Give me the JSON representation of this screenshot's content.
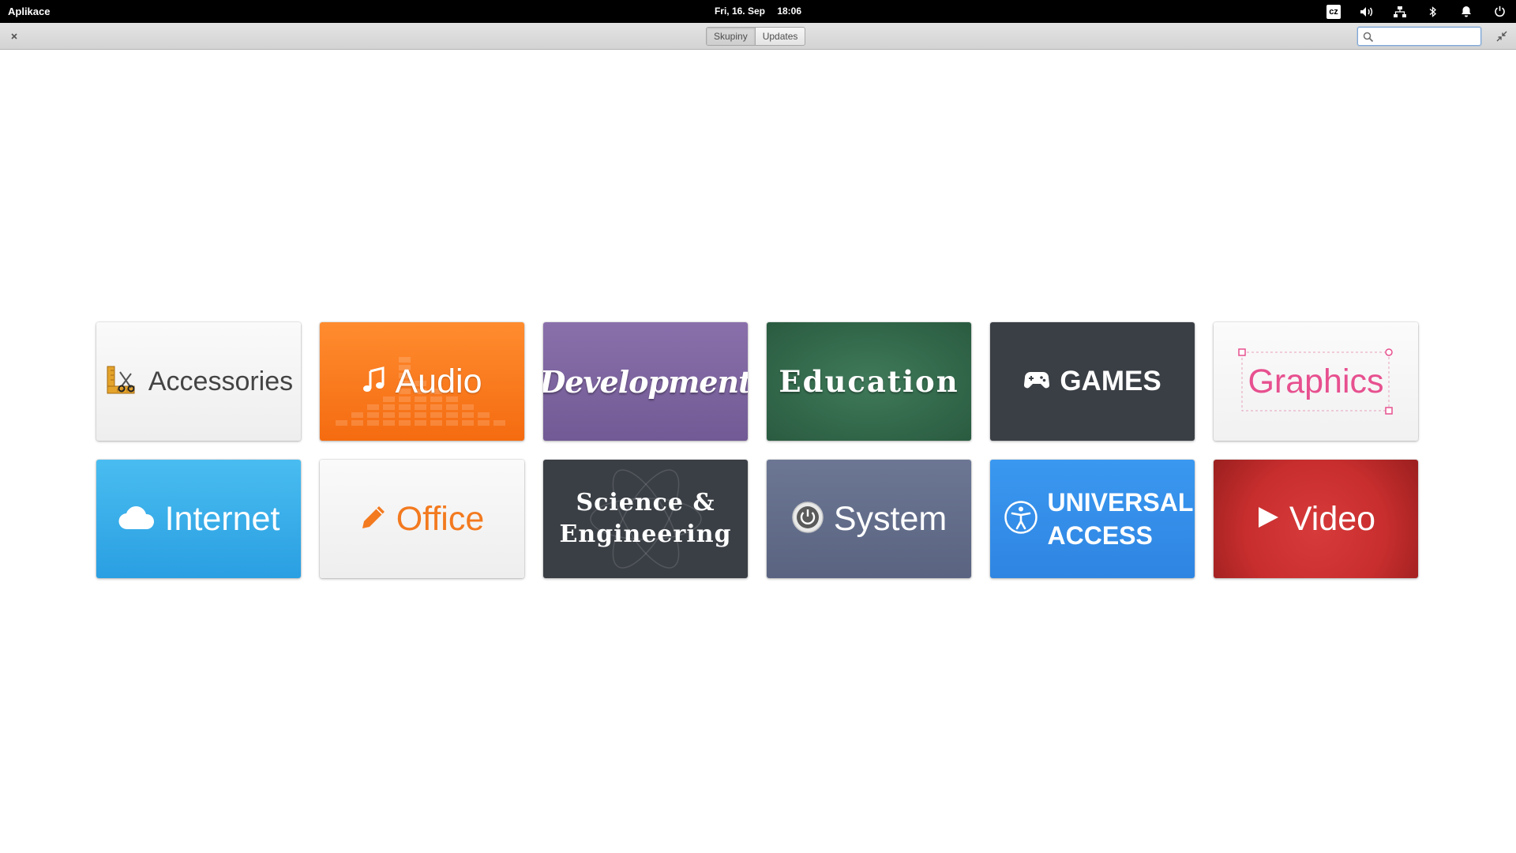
{
  "panel": {
    "title": "Aplikace",
    "date": "Fri, 16. Sep",
    "time": "18:06",
    "keyboard_layout": "cz",
    "indicator_icons": [
      "volume-icon",
      "network-icon",
      "bluetooth-icon",
      "notification-bell-icon",
      "power-icon"
    ]
  },
  "header": {
    "close_icon": "close-icon",
    "maximize_icon": "restore-icon",
    "modes": [
      "Skupiny",
      "Updates"
    ],
    "active_mode": "Skupiny",
    "search": {
      "value": "",
      "placeholder": "",
      "icon": "search-icon"
    }
  },
  "categories": [
    {
      "label": "Accessories",
      "icon": "accessories-icon",
      "color": "#f2f2f2"
    },
    {
      "label": "Audio",
      "icon": "music-note-icon",
      "color": "#f7771c"
    },
    {
      "label": "Development",
      "icon": "",
      "color": "#7c63a0"
    },
    {
      "label": "Education",
      "icon": "",
      "color": "#316a4c"
    },
    {
      "label": "GAMES",
      "icon": "gamepad-icon",
      "color": "#3a3f45"
    },
    {
      "label": "Graphics",
      "icon": "selection-frame-icon",
      "color": "#e7508f"
    },
    {
      "label": "Internet",
      "icon": "cloud-icon",
      "color": "#36aee9"
    },
    {
      "label": "Office",
      "icon": "pencil-icon",
      "color": "#f37a1f"
    },
    {
      "label": "Science & Engineering",
      "icon": "atom-icon",
      "color": "#3a3f45"
    },
    {
      "label": "System",
      "icon": "power-knob-icon",
      "color": "#636d8b"
    },
    {
      "label": "UNIVERSAL ACCESS",
      "icon": "accessibility-icon",
      "color": "#348ee8"
    },
    {
      "label": "Video",
      "icon": "play-icon",
      "color": "#cf3333"
    }
  ]
}
